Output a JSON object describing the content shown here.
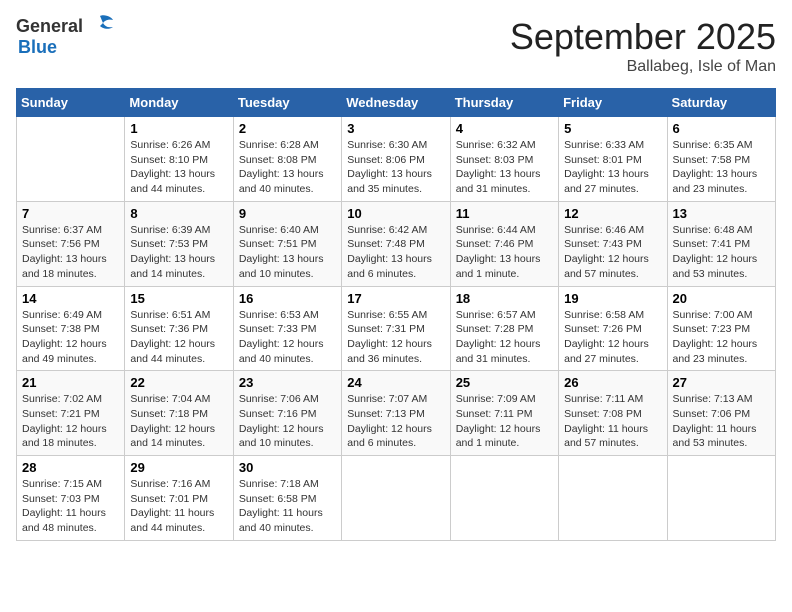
{
  "logo": {
    "general": "General",
    "blue": "Blue"
  },
  "header": {
    "month": "September 2025",
    "location": "Ballabeg, Isle of Man"
  },
  "days_of_week": [
    "Sunday",
    "Monday",
    "Tuesday",
    "Wednesday",
    "Thursday",
    "Friday",
    "Saturday"
  ],
  "weeks": [
    [
      {
        "day": "",
        "info": ""
      },
      {
        "day": "1",
        "info": "Sunrise: 6:26 AM\nSunset: 8:10 PM\nDaylight: 13 hours\nand 44 minutes."
      },
      {
        "day": "2",
        "info": "Sunrise: 6:28 AM\nSunset: 8:08 PM\nDaylight: 13 hours\nand 40 minutes."
      },
      {
        "day": "3",
        "info": "Sunrise: 6:30 AM\nSunset: 8:06 PM\nDaylight: 13 hours\nand 35 minutes."
      },
      {
        "day": "4",
        "info": "Sunrise: 6:32 AM\nSunset: 8:03 PM\nDaylight: 13 hours\nand 31 minutes."
      },
      {
        "day": "5",
        "info": "Sunrise: 6:33 AM\nSunset: 8:01 PM\nDaylight: 13 hours\nand 27 minutes."
      },
      {
        "day": "6",
        "info": "Sunrise: 6:35 AM\nSunset: 7:58 PM\nDaylight: 13 hours\nand 23 minutes."
      }
    ],
    [
      {
        "day": "7",
        "info": "Sunrise: 6:37 AM\nSunset: 7:56 PM\nDaylight: 13 hours\nand 18 minutes."
      },
      {
        "day": "8",
        "info": "Sunrise: 6:39 AM\nSunset: 7:53 PM\nDaylight: 13 hours\nand 14 minutes."
      },
      {
        "day": "9",
        "info": "Sunrise: 6:40 AM\nSunset: 7:51 PM\nDaylight: 13 hours\nand 10 minutes."
      },
      {
        "day": "10",
        "info": "Sunrise: 6:42 AM\nSunset: 7:48 PM\nDaylight: 13 hours\nand 6 minutes."
      },
      {
        "day": "11",
        "info": "Sunrise: 6:44 AM\nSunset: 7:46 PM\nDaylight: 13 hours\nand 1 minute."
      },
      {
        "day": "12",
        "info": "Sunrise: 6:46 AM\nSunset: 7:43 PM\nDaylight: 12 hours\nand 57 minutes."
      },
      {
        "day": "13",
        "info": "Sunrise: 6:48 AM\nSunset: 7:41 PM\nDaylight: 12 hours\nand 53 minutes."
      }
    ],
    [
      {
        "day": "14",
        "info": "Sunrise: 6:49 AM\nSunset: 7:38 PM\nDaylight: 12 hours\nand 49 minutes."
      },
      {
        "day": "15",
        "info": "Sunrise: 6:51 AM\nSunset: 7:36 PM\nDaylight: 12 hours\nand 44 minutes."
      },
      {
        "day": "16",
        "info": "Sunrise: 6:53 AM\nSunset: 7:33 PM\nDaylight: 12 hours\nand 40 minutes."
      },
      {
        "day": "17",
        "info": "Sunrise: 6:55 AM\nSunset: 7:31 PM\nDaylight: 12 hours\nand 36 minutes."
      },
      {
        "day": "18",
        "info": "Sunrise: 6:57 AM\nSunset: 7:28 PM\nDaylight: 12 hours\nand 31 minutes."
      },
      {
        "day": "19",
        "info": "Sunrise: 6:58 AM\nSunset: 7:26 PM\nDaylight: 12 hours\nand 27 minutes."
      },
      {
        "day": "20",
        "info": "Sunrise: 7:00 AM\nSunset: 7:23 PM\nDaylight: 12 hours\nand 23 minutes."
      }
    ],
    [
      {
        "day": "21",
        "info": "Sunrise: 7:02 AM\nSunset: 7:21 PM\nDaylight: 12 hours\nand 18 minutes."
      },
      {
        "day": "22",
        "info": "Sunrise: 7:04 AM\nSunset: 7:18 PM\nDaylight: 12 hours\nand 14 minutes."
      },
      {
        "day": "23",
        "info": "Sunrise: 7:06 AM\nSunset: 7:16 PM\nDaylight: 12 hours\nand 10 minutes."
      },
      {
        "day": "24",
        "info": "Sunrise: 7:07 AM\nSunset: 7:13 PM\nDaylight: 12 hours\nand 6 minutes."
      },
      {
        "day": "25",
        "info": "Sunrise: 7:09 AM\nSunset: 7:11 PM\nDaylight: 12 hours\nand 1 minute."
      },
      {
        "day": "26",
        "info": "Sunrise: 7:11 AM\nSunset: 7:08 PM\nDaylight: 11 hours\nand 57 minutes."
      },
      {
        "day": "27",
        "info": "Sunrise: 7:13 AM\nSunset: 7:06 PM\nDaylight: 11 hours\nand 53 minutes."
      }
    ],
    [
      {
        "day": "28",
        "info": "Sunrise: 7:15 AM\nSunset: 7:03 PM\nDaylight: 11 hours\nand 48 minutes."
      },
      {
        "day": "29",
        "info": "Sunrise: 7:16 AM\nSunset: 7:01 PM\nDaylight: 11 hours\nand 44 minutes."
      },
      {
        "day": "30",
        "info": "Sunrise: 7:18 AM\nSunset: 6:58 PM\nDaylight: 11 hours\nand 40 minutes."
      },
      {
        "day": "",
        "info": ""
      },
      {
        "day": "",
        "info": ""
      },
      {
        "day": "",
        "info": ""
      },
      {
        "day": "",
        "info": ""
      }
    ]
  ]
}
